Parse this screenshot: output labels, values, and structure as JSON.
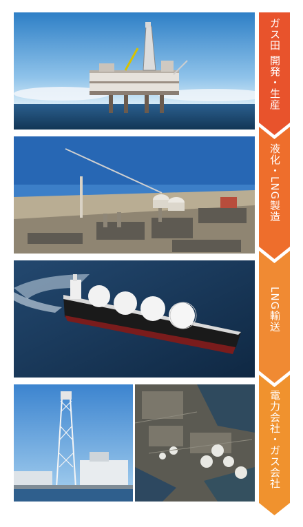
{
  "steps": [
    {
      "label": "ガス田 開発・生産",
      "color": "#e8532c"
    },
    {
      "label": "液化・LNG製造",
      "color": "#ee6e2c"
    },
    {
      "label": "LNG輸送",
      "color": "#f08a33"
    },
    {
      "label": "電力会社・ガス会社",
      "color": "#f0922e"
    }
  ],
  "photos": {
    "oil_platform": "offshore-platform-photo",
    "lng_plant": "liquefaction-plant-photo",
    "lng_carrier": "lng-carrier-ship-photo",
    "power_station": "power-station-photo",
    "gas_terminal": "lng-terminal-aerial-photo"
  }
}
